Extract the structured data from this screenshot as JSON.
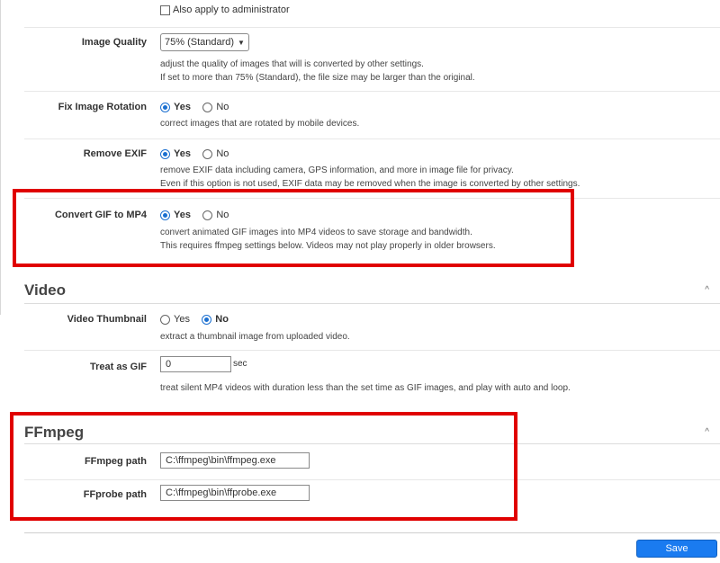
{
  "admin_apply": {
    "label": "Also apply to administrator"
  },
  "image_quality": {
    "label": "Image Quality",
    "value": "75% (Standard)",
    "desc1": "adjust the quality of images that will is converted by other settings.",
    "desc2": "If set to more than 75% (Standard), the file size may be larger than the original."
  },
  "fix_rotation": {
    "label": "Fix Image Rotation",
    "yes": "Yes",
    "no": "No",
    "selected": "yes",
    "desc1": "correct images that are rotated by mobile devices."
  },
  "remove_exif": {
    "label": "Remove EXIF",
    "yes": "Yes",
    "no": "No",
    "selected": "yes",
    "desc1": "remove EXIF data including camera, GPS information, and more in image file for privacy.",
    "desc2": "Even if this option is not used, EXIF data may be removed when the image is converted by other settings."
  },
  "convert_gif": {
    "label": "Convert GIF to MP4",
    "yes": "Yes",
    "no": "No",
    "selected": "yes",
    "desc1": "convert animated GIF images into MP4 videos to save storage and bandwidth.",
    "desc2": "This requires ffmpeg settings below. Videos may not play properly in older browsers."
  },
  "video_section": {
    "title": "Video",
    "toggle": "^"
  },
  "video_thumbnail": {
    "label": "Video Thumbnail",
    "yes": "Yes",
    "no": "No",
    "selected": "no",
    "desc1": "extract a thumbnail image from uploaded video."
  },
  "treat_as_gif": {
    "label": "Treat as GIF",
    "value": "0",
    "unit": "sec",
    "desc1": "treat silent MP4 videos with duration less than the set time as GIF images, and play with auto and loop."
  },
  "ffmpeg_section": {
    "title": "FFmpeg",
    "toggle": "^"
  },
  "ffmpeg_path": {
    "label": "FFmpeg path",
    "value": "C:\\ffmpeg\\bin\\ffmpeg.exe"
  },
  "ffprobe_path": {
    "label": "FFprobe path",
    "value": "C:\\ffmpeg\\bin\\ffprobe.exe"
  },
  "save_button": {
    "label": "Save"
  },
  "colors": {
    "highlight_box": "#e00000",
    "accent": "#1a7bf0"
  }
}
